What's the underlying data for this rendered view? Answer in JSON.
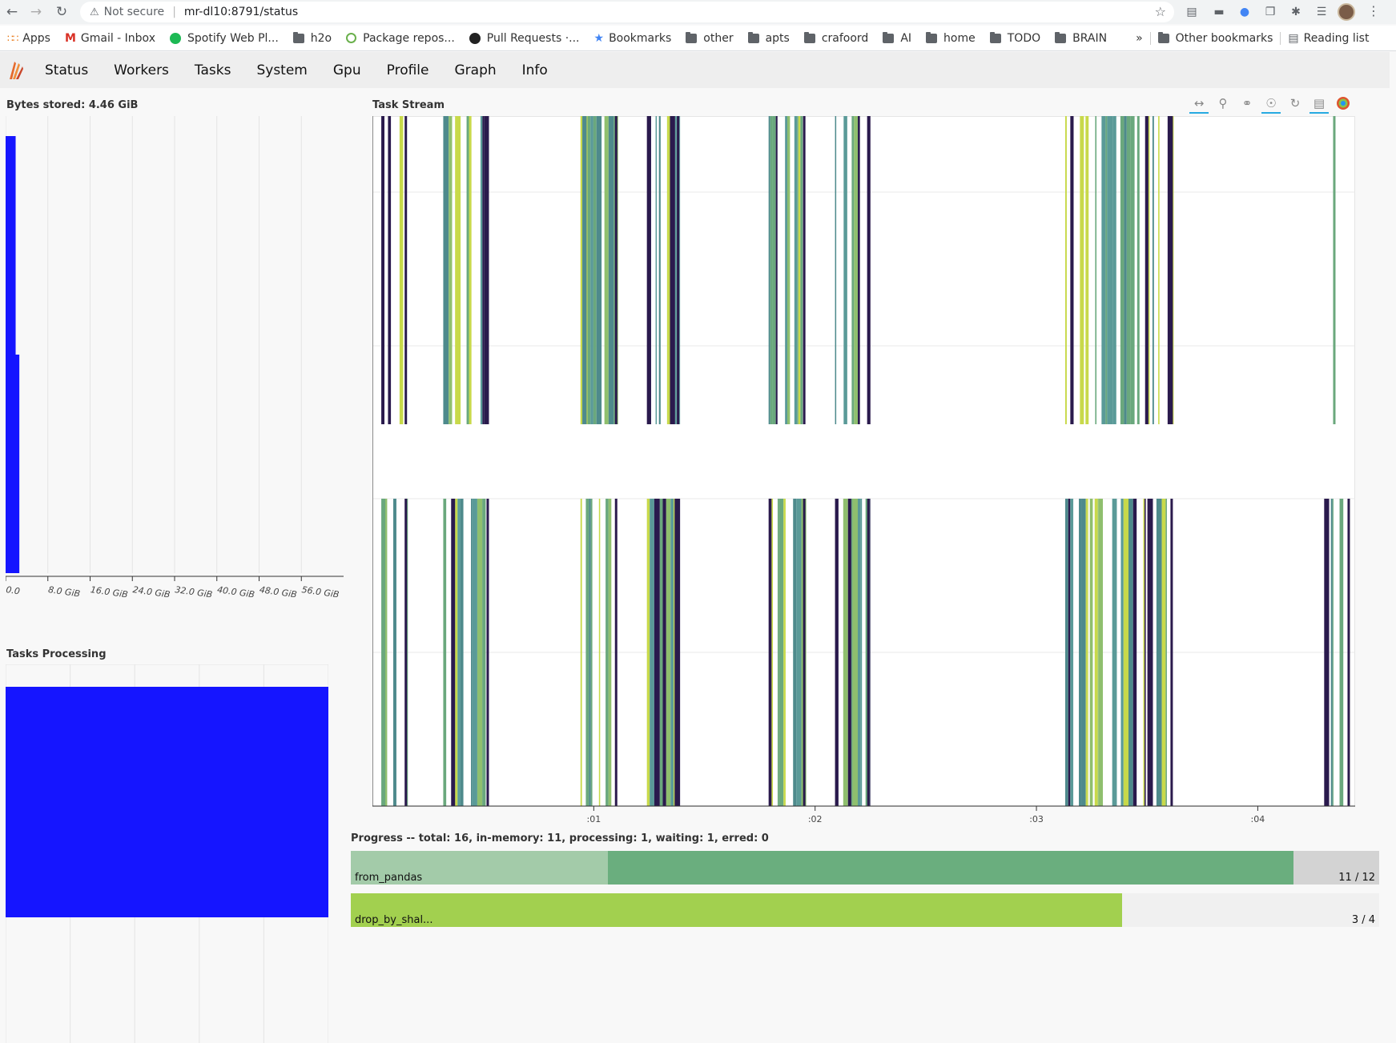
{
  "browser": {
    "not_secure": "Not secure",
    "url": "mr-dl10:8791/status"
  },
  "bookmarks": [
    {
      "label": "Apps",
      "icon": "apps-grid-icon"
    },
    {
      "label": "Gmail - Inbox",
      "icon": "gmail-icon"
    },
    {
      "label": "Spotify Web Pl...",
      "icon": "spotify-icon"
    },
    {
      "label": "h2o",
      "icon": "folder-icon"
    },
    {
      "label": "Package repos...",
      "icon": "package-icon"
    },
    {
      "label": "Pull Requests ·...",
      "icon": "github-icon"
    },
    {
      "label": "Bookmarks",
      "icon": "star-icon"
    },
    {
      "label": "other",
      "icon": "folder-icon"
    },
    {
      "label": "apts",
      "icon": "folder-icon"
    },
    {
      "label": "crafoord",
      "icon": "folder-icon"
    },
    {
      "label": "AI",
      "icon": "folder-icon"
    },
    {
      "label": "home",
      "icon": "folder-icon"
    },
    {
      "label": "TODO",
      "icon": "folder-icon"
    },
    {
      "label": "BRAIN",
      "icon": "folder-icon"
    }
  ],
  "bookmarks_overflow": "»",
  "other_bookmarks": "Other bookmarks",
  "reading_list": "Reading list",
  "navbar": {
    "items": [
      "Status",
      "Workers",
      "Tasks",
      "System",
      "Gpu",
      "Profile",
      "Graph",
      "Info"
    ]
  },
  "bytes_panel": {
    "title": "Bytes stored: 4.46 GiB"
  },
  "tasks_panel": {
    "title": "Tasks Processing"
  },
  "stream_panel": {
    "title": "Task Stream"
  },
  "chart_data": [
    {
      "type": "bar",
      "orientation": "horizontal",
      "title": "Bytes stored: 4.46 GiB",
      "xlim": [
        0,
        64
      ],
      "x_unit": "GiB",
      "tick_labels": [
        "0.0",
        "8.0 GiB",
        "16.0 GiB",
        "24.0 GiB",
        "32.0 GiB",
        "40.0 GiB",
        "48.0 GiB",
        "56.0 GiB"
      ],
      "tick_values": [
        0,
        8,
        16,
        24,
        32,
        40,
        48,
        56
      ],
      "bars": [
        {
          "worker": 0,
          "value": 1.9,
          "color": "#1515ff"
        },
        {
          "worker": 1,
          "value": 2.6,
          "color": "#1515ff"
        }
      ]
    },
    {
      "type": "bar",
      "orientation": "horizontal",
      "title": "Tasks Processing",
      "xlim": [
        0,
        1
      ],
      "bars": [
        {
          "worker": 0,
          "value": 1,
          "color": "#1515ff"
        }
      ]
    },
    {
      "type": "gantt",
      "title": "Task Stream",
      "xlim": [
        -0.0,
        4.44
      ],
      "tick_labels": [
        ":01",
        ":02",
        ":03",
        ":04"
      ],
      "tick_values": [
        1,
        2,
        3,
        4
      ],
      "lanes": 2,
      "palette": [
        "#6aa87d",
        "#4e8a8c",
        "#c8d94a",
        "#2a1a4d",
        "#8fbf6e",
        "#5a9a98"
      ],
      "clusters": [
        {
          "start": 0.04,
          "end": 0.16
        },
        {
          "start": 0.32,
          "end": 0.53
        },
        {
          "start": 0.94,
          "end": 1.11
        },
        {
          "start": 1.24,
          "end": 1.39
        },
        {
          "start": 1.79,
          "end": 1.96
        },
        {
          "start": 2.09,
          "end": 2.25
        },
        {
          "start": 3.13,
          "end": 3.62
        },
        {
          "start": 4.3,
          "end": 4.42
        }
      ]
    }
  ],
  "progress": {
    "header": "Progress -- total: 16, in-memory: 11, processing: 1, waiting: 1, erred: 0",
    "bars": [
      {
        "name": "from_pandas",
        "count": "11 / 12",
        "released": 3,
        "memory": 8,
        "processing": 0,
        "total": 12,
        "color_released": "#a3cba9",
        "color_memory": "#6aae7e"
      },
      {
        "name": "drop_by_shal...",
        "count": "3 / 4",
        "released": 0,
        "memory": 3,
        "processing": 0,
        "total": 4,
        "color_released": "#cfe89a",
        "color_memory": "#a2d04f"
      }
    ]
  }
}
